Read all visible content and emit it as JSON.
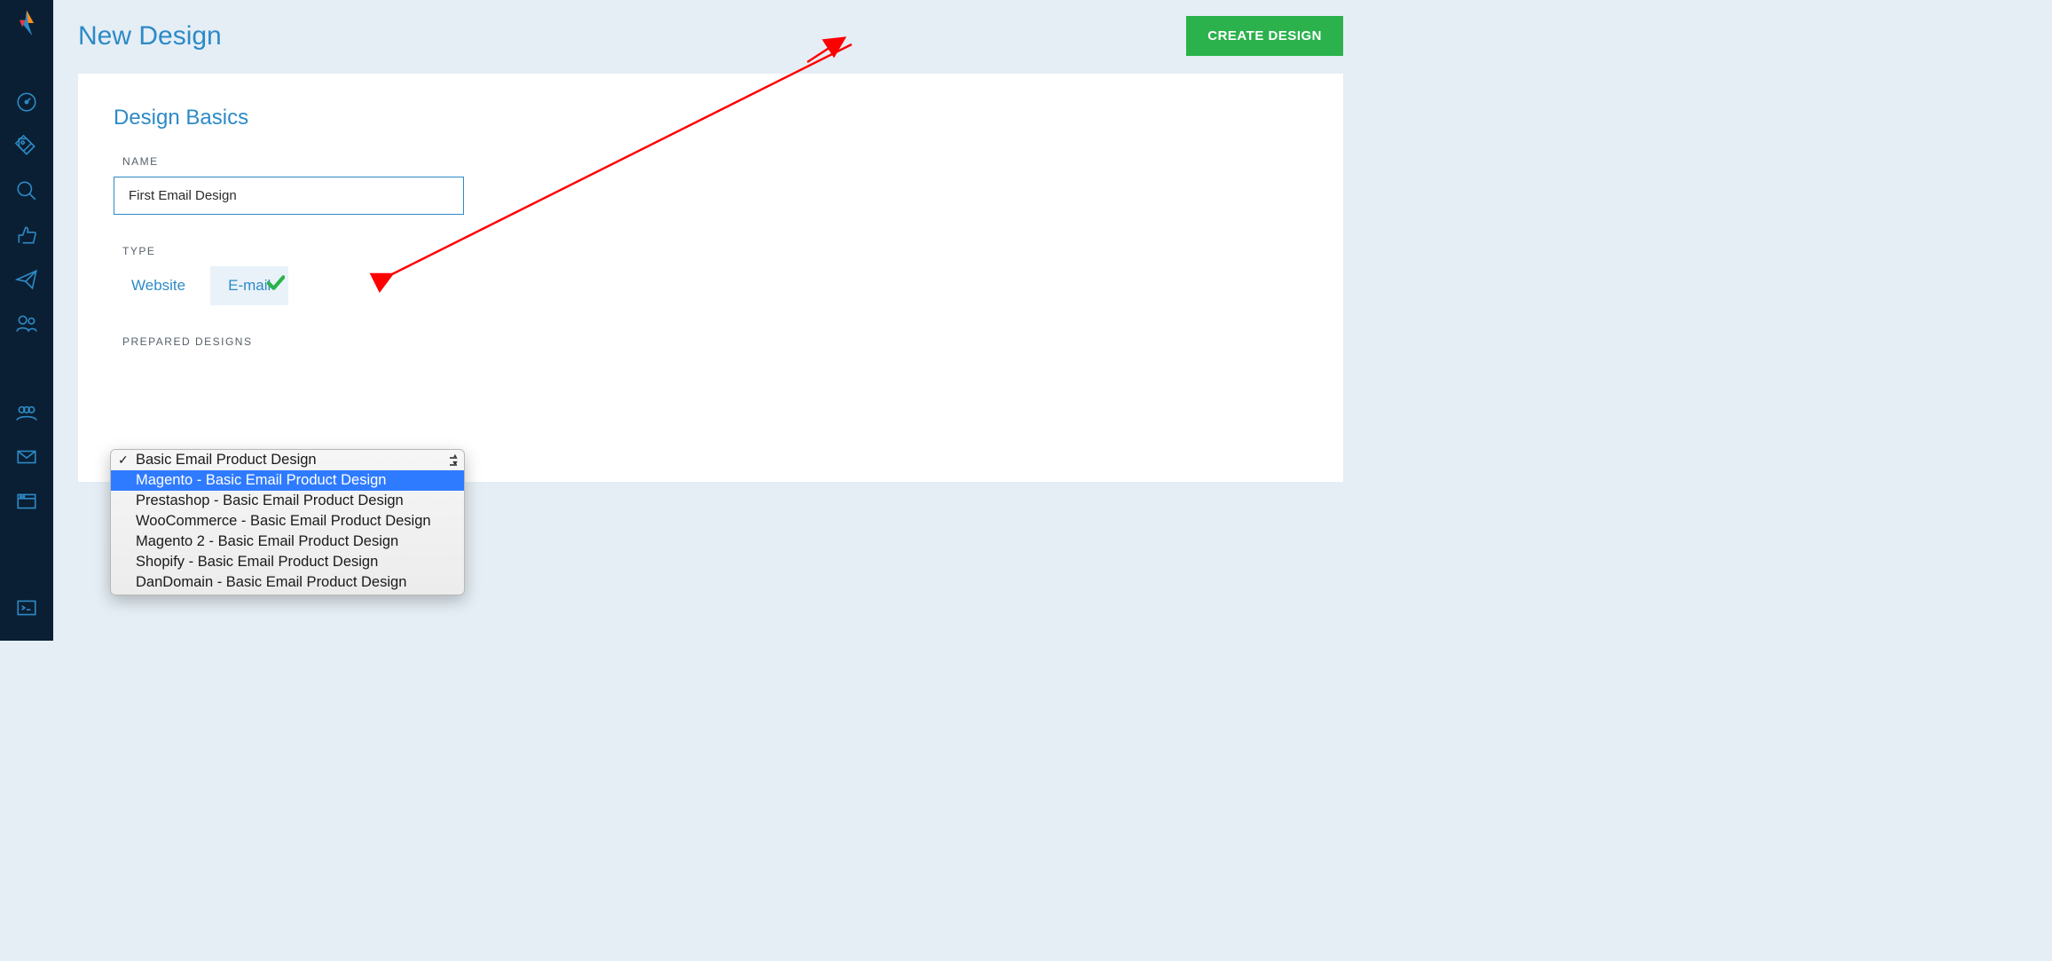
{
  "page": {
    "title": "New Design",
    "create_button": "CREATE DESIGN"
  },
  "section": {
    "title": "Design Basics"
  },
  "fields": {
    "name_label": "NAME",
    "name_value": "First Email Design",
    "type_label": "TYPE",
    "type_options": {
      "website": "Website",
      "email": "E-mail"
    },
    "prepared_label": "PREPARED DESIGNS"
  },
  "dropdown": {
    "selected": "Basic Email Product Design",
    "highlighted": "Magento - Basic Email Product Design",
    "options": [
      "Basic Email Product Design",
      "Magento - Basic Email Product Design",
      "Prestashop - Basic Email Product Design",
      "WooCommerce - Basic Email Product Design",
      "Magento 2 - Basic Email Product Design",
      "Shopify - Basic Email Product Design",
      "DanDomain - Basic Email Product Design"
    ]
  },
  "sidebar_icons": [
    "dashboard-icon",
    "tag-icon",
    "search-icon",
    "thumbs-up-icon",
    "send-icon",
    "users-icon",
    "group-icon",
    "mail-icon",
    "browser-icon",
    "terminal-icon"
  ]
}
